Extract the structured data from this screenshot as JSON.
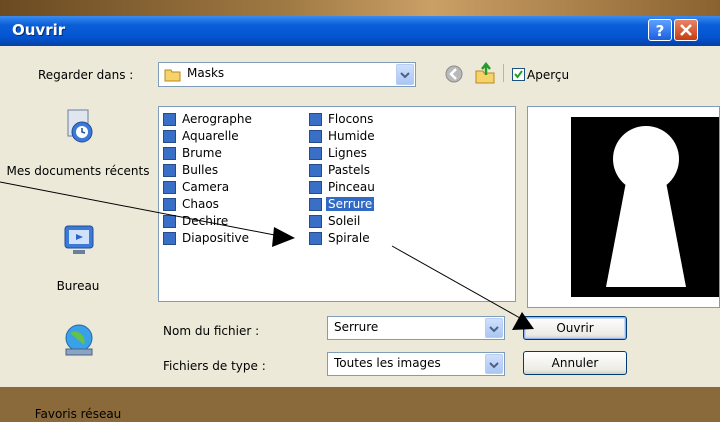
{
  "window": {
    "title": "Ouvrir"
  },
  "toolbar": {
    "look_in_label": "Regarder dans :",
    "look_in_value": "Masks",
    "preview_label": "Aperçu",
    "preview_checked": true
  },
  "places": [
    {
      "label": "Mes documents récents",
      "icon": "recent-documents-icon"
    },
    {
      "label": "Bureau",
      "icon": "desktop-icon"
    },
    {
      "label": "Favoris réseau",
      "icon": "network-places-icon"
    }
  ],
  "files": {
    "col1": [
      "Aerographe",
      "Aquarelle",
      "Brume",
      "Bulles",
      "Camera",
      "Chaos",
      "Dechire",
      "Diapositive"
    ],
    "col2": [
      "Flocons",
      "Humide",
      "Lignes",
      "Pastels",
      "Pinceau",
      "Serrure",
      "Soleil",
      "Spirale"
    ],
    "selected": "Serrure"
  },
  "form": {
    "filename_label": "Nom du fichier :",
    "filename_value": "Serrure",
    "filetype_label": "Fichiers de type :",
    "filetype_value": "Toutes les images"
  },
  "buttons": {
    "open": "Ouvrir",
    "cancel": "Annuler"
  },
  "colors": {
    "title_blue": "#0454d0",
    "selection": "#316ac5",
    "arrow": "#000000"
  }
}
